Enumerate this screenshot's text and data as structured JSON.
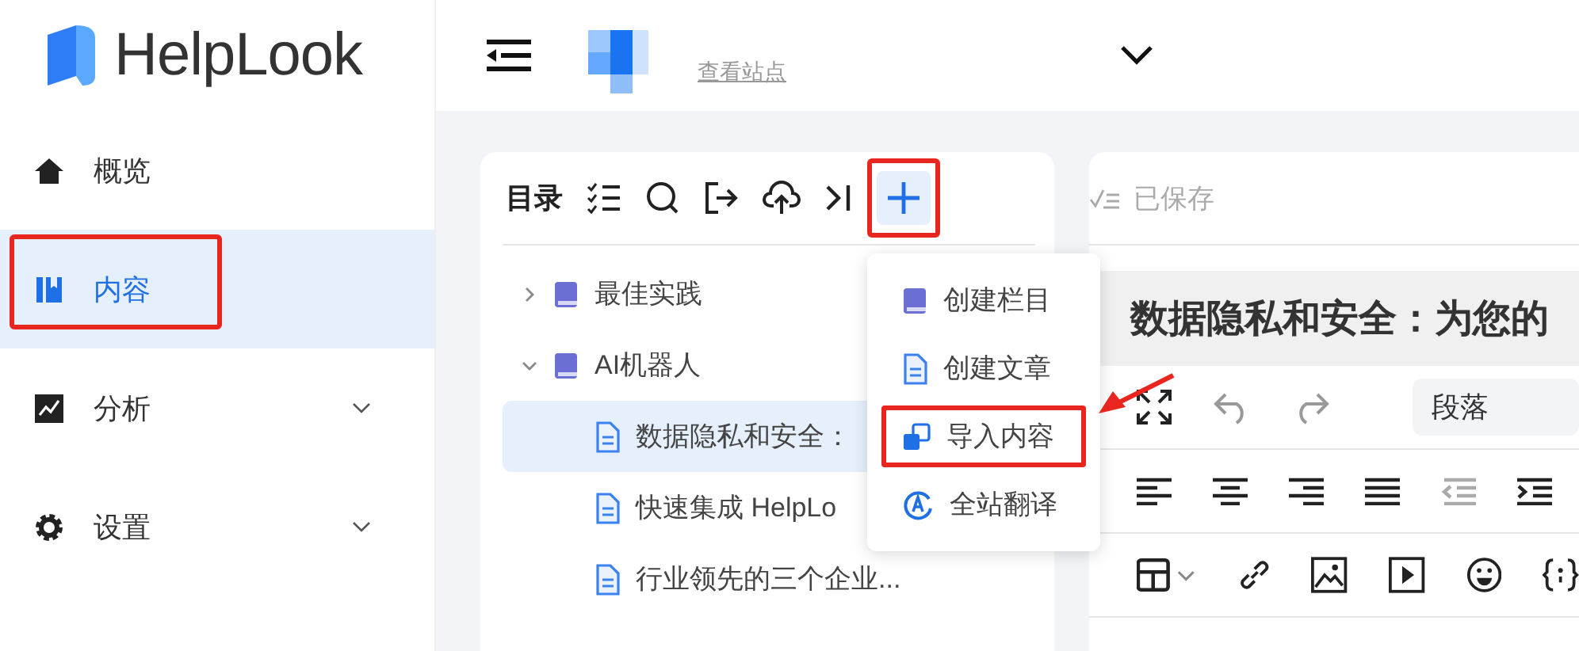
{
  "brand": {
    "name": "HelpLook"
  },
  "sidebar": {
    "items": [
      {
        "label": "概览",
        "kind": "home",
        "selected": false,
        "expandable": false,
        "highlighted": false
      },
      {
        "label": "内容",
        "kind": "content",
        "selected": true,
        "expandable": false,
        "highlighted": true
      },
      {
        "label": "分析",
        "kind": "analytics",
        "selected": false,
        "expandable": true,
        "highlighted": false
      },
      {
        "label": "设置",
        "kind": "settings",
        "selected": false,
        "expandable": true,
        "highlighted": false
      }
    ]
  },
  "header": {
    "view_site_link": "查看站点"
  },
  "catalog": {
    "title": "目录",
    "add_button": {
      "active": true,
      "highlighted": true
    },
    "tree": [
      {
        "label": "最佳实践",
        "kind": "folder",
        "expanded": false,
        "selected": false
      },
      {
        "label": "AI机器人",
        "kind": "folder",
        "expanded": true,
        "selected": false,
        "children": [
          {
            "label": "数据隐私和安全：",
            "kind": "doc",
            "selected": true
          },
          {
            "label": "快速集成 HelpLo",
            "kind": "doc",
            "selected": false
          },
          {
            "label": "行业领先的三个企业...",
            "kind": "doc",
            "selected": false
          }
        ]
      }
    ]
  },
  "add_menu": {
    "items": [
      {
        "label": "创建栏目",
        "kind": "folder",
        "highlighted": false
      },
      {
        "label": "创建文章",
        "kind": "doc",
        "highlighted": false
      },
      {
        "label": "导入内容",
        "kind": "import",
        "highlighted": true
      },
      {
        "label": "全站翻译",
        "kind": "translate",
        "highlighted": false
      }
    ]
  },
  "editor": {
    "save_status": "已保存",
    "title": "数据隐私和安全：为您的",
    "block_format": "段落"
  }
}
